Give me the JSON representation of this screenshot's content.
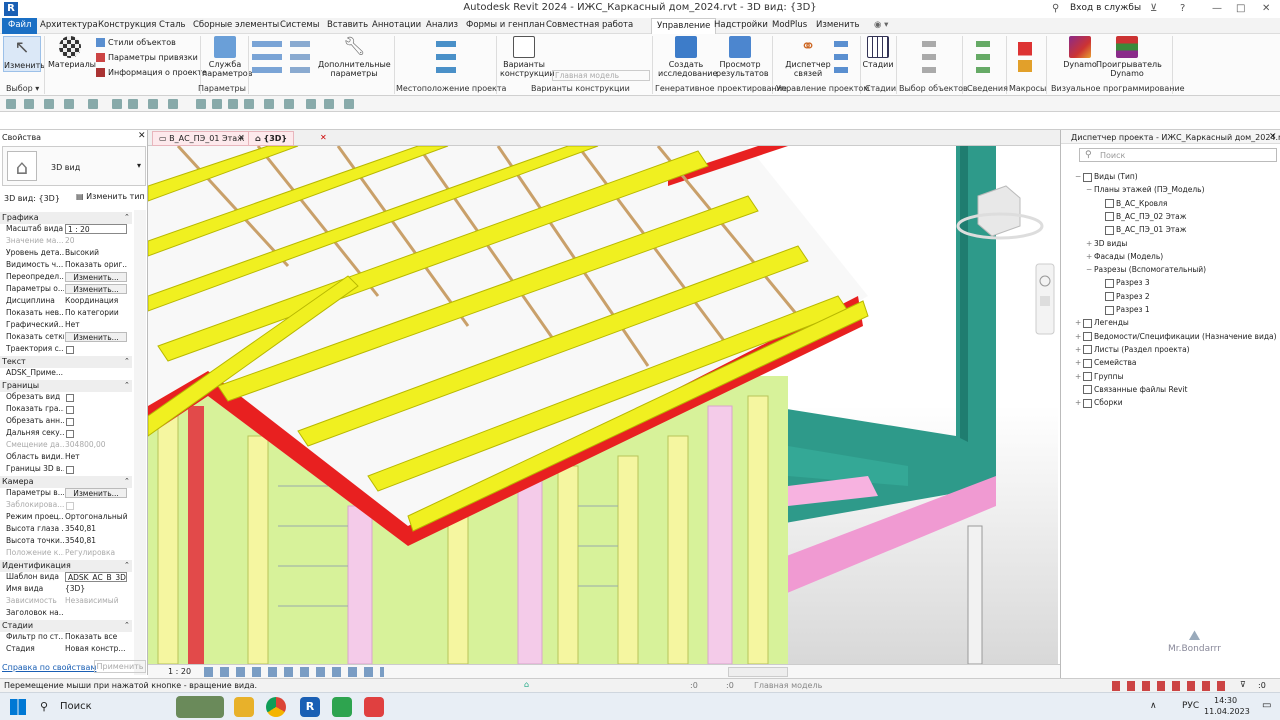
{
  "app": {
    "title": "Autodesk Revit 2024 - ИЖС_Каркасный дом_2024.rvt - 3D вид: {3D}",
    "login": "Вход в службы"
  },
  "menu": [
    "Архитектура",
    "Конструкция",
    "Сталь",
    "Сборные элементы",
    "Системы",
    "Вставить",
    "Аннотации",
    "Анализ",
    "Формы и генплан",
    "Совместная работа",
    "Управление",
    "Надстройки",
    "ModPlus",
    "Изменить"
  ],
  "menu_file": "Файл",
  "menu_active": "Управление",
  "ribbon": {
    "modify": "Изменить",
    "materials": "Материалы",
    "object_styles": "Стили объектов",
    "snaps": "Параметры привязки",
    "project_info": "Информация о проекте",
    "params_service": [
      "Служба",
      "параметров"
    ],
    "additional_params": [
      "Дополнительные",
      "параметры"
    ],
    "design_options": [
      "Варианты",
      "конструкции"
    ],
    "main_model": "Главная модель",
    "create_study": [
      "Создать",
      "исследование"
    ],
    "view_results": [
      "Просмотр",
      "результатов"
    ],
    "link_manager": [
      "Диспетчер",
      "связей"
    ],
    "phases": "Стадии",
    "dynamo": "Dynamo",
    "dynamo_player": [
      "Проигрыватель",
      "Dynamo"
    ]
  },
  "groups": [
    "Выбор",
    "Параметры",
    "Местоположение проекта",
    "Варианты конструкции",
    "Генеративное проектирование",
    "Управление проектом",
    "Стадии",
    "Выбор объектов",
    "Сведения",
    "Макросы",
    "Визуальное программирование"
  ],
  "props": {
    "title": "Свойства",
    "type_name": "3D вид",
    "selector": "3D вид: {3D}",
    "edit_type": "Изменить тип",
    "sections": {
      "graphics": "Графика",
      "text": "Текст",
      "extents": "Границы",
      "camera": "Камера",
      "identity": "Идентификация",
      "phases": "Стадии"
    },
    "graphics": [
      {
        "k": "Масштаб вида",
        "v": "1 : 20",
        "kind": "box"
      },
      {
        "k": "Значение ма...",
        "v": "20",
        "kind": "grey"
      },
      {
        "k": "Уровень дета...",
        "v": "Высокий",
        "kind": "text"
      },
      {
        "k": "Видимость ч...",
        "v": "Показать ориг...",
        "kind": "text"
      },
      {
        "k": "Переопредел...",
        "v": "Изменить...",
        "kind": "btn"
      },
      {
        "k": "Параметры о...",
        "v": "Изменить...",
        "kind": "btn"
      },
      {
        "k": "Дисциплина",
        "v": "Координация",
        "kind": "text"
      },
      {
        "k": "Показать нев...",
        "v": "По категории",
        "kind": "text"
      },
      {
        "k": "Графический...",
        "v": "Нет",
        "kind": "text"
      },
      {
        "k": "Показать сетки",
        "v": "Изменить...",
        "kind": "btn"
      },
      {
        "k": "Траектория с...",
        "v": "",
        "kind": "chk"
      }
    ],
    "text": [
      {
        "k": "ADSK_Приме...",
        "v": "",
        "kind": "text"
      }
    ],
    "extents": [
      {
        "k": "Обрезать вид",
        "v": "",
        "kind": "chk"
      },
      {
        "k": "Показать гра...",
        "v": "",
        "kind": "chk"
      },
      {
        "k": "Обрезать анн...",
        "v": "",
        "kind": "chk"
      },
      {
        "k": "Дальняя секу...",
        "v": "",
        "kind": "chk"
      },
      {
        "k": "Смещение да...",
        "v": "304800,00",
        "kind": "grey"
      },
      {
        "k": "Область види...",
        "v": "Нет",
        "kind": "text"
      },
      {
        "k": "Границы 3D в...",
        "v": "",
        "kind": "chk"
      }
    ],
    "camera": [
      {
        "k": "Параметры в...",
        "v": "Изменить...",
        "kind": "btn"
      },
      {
        "k": "Заблокирова...",
        "v": "",
        "kind": "greychk"
      },
      {
        "k": "Режим проец...",
        "v": "Ортогональный",
        "kind": "text"
      },
      {
        "k": "Высота глаза ...",
        "v": "3540,81",
        "kind": "text"
      },
      {
        "k": "Высота точки...",
        "v": "3540,81",
        "kind": "text"
      },
      {
        "k": "Положение к...",
        "v": "Регулировка",
        "kind": "grey"
      }
    ],
    "identity": [
      {
        "k": "Шаблон вида",
        "v": "ADSK_АС_В_3D",
        "kind": "box"
      },
      {
        "k": "Имя вида",
        "v": "{3D}",
        "kind": "text"
      },
      {
        "k": "Зависимость",
        "v": "Независимый",
        "kind": "grey"
      },
      {
        "k": "Заголовок на...",
        "v": "",
        "kind": "text"
      }
    ],
    "phases": [
      {
        "k": "Фильтр по ст...",
        "v": "Показать все",
        "kind": "text"
      },
      {
        "k": "Стадия",
        "v": "Новая констр...",
        "kind": "text"
      }
    ],
    "help": "Справка по свойствам",
    "apply": "Применить"
  },
  "tabs": [
    "В_АС_ПЭ_01 Этаж",
    "{3D}"
  ],
  "scale": "1 : 20",
  "browser": {
    "title": "Диспетчер проекта - ИЖС_Каркасный дом_2024.rvt",
    "search": "Поиск",
    "nodes": [
      {
        "t": "Виды (Тип)",
        "lvl": 0,
        "tg": "−",
        "ic": 1
      },
      {
        "t": "Планы этажей (ПЭ_Модель)",
        "lvl": 1,
        "tg": "−",
        "ic": 0
      },
      {
        "t": "В_АС_Кровля",
        "lvl": 2,
        "tg": "",
        "ic": 1
      },
      {
        "t": "В_АС_ПЭ_02 Этаж",
        "lvl": 2,
        "tg": "",
        "ic": 1
      },
      {
        "t": "В_АС_ПЭ_01 Этаж",
        "lvl": 2,
        "tg": "",
        "ic": 1
      },
      {
        "t": "3D виды",
        "lvl": 1,
        "tg": "+",
        "ic": 0
      },
      {
        "t": "Фасады (Модель)",
        "lvl": 1,
        "tg": "+",
        "ic": 0
      },
      {
        "t": "Разрезы (Вспомогательный)",
        "lvl": 1,
        "tg": "−",
        "ic": 0
      },
      {
        "t": "Разрез 3",
        "lvl": 2,
        "tg": "",
        "ic": 1
      },
      {
        "t": "Разрез 2",
        "lvl": 2,
        "tg": "",
        "ic": 1
      },
      {
        "t": "Разрез 1",
        "lvl": 2,
        "tg": "",
        "ic": 1
      },
      {
        "t": "Легенды",
        "lvl": 0,
        "tg": "+",
        "ic": 1
      },
      {
        "t": "Ведомости/Спецификации (Назначение вида)",
        "lvl": 0,
        "tg": "+",
        "ic": 1
      },
      {
        "t": "Листы (Раздел проекта)",
        "lvl": 0,
        "tg": "+",
        "ic": 1
      },
      {
        "t": "Семейства",
        "lvl": 0,
        "tg": "+",
        "ic": 1
      },
      {
        "t": "Группы",
        "lvl": 0,
        "tg": "+",
        "ic": 1
      },
      {
        "t": "Связанные файлы Revit",
        "lvl": 0,
        "tg": "",
        "ic": 1
      },
      {
        "t": "Сборки",
        "lvl": 0,
        "tg": "+",
        "ic": 1
      }
    ]
  },
  "status": {
    "hint": "Перемещение мыши при нажатой кнопке - вращение вида.",
    "zero1": ":0",
    "zero2": ":0",
    "model": "Главная модель"
  },
  "taskbar": {
    "search": "Поиск",
    "lang": "РУС",
    "time": "14:30",
    "date": "11.04.2023"
  },
  "watermark": "Mr.Bondarrr"
}
